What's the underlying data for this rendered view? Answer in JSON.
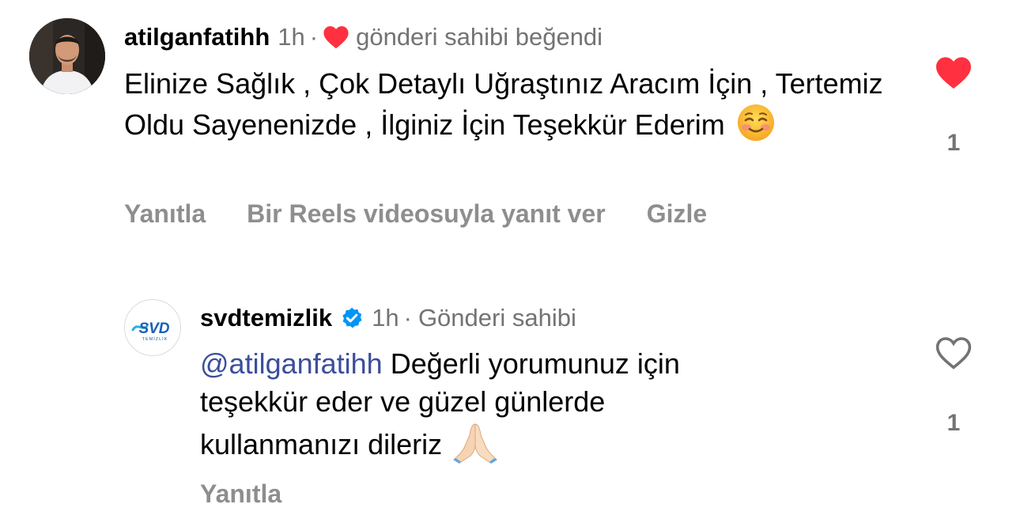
{
  "comments": [
    {
      "username": "atilganfatihh",
      "time": "1h",
      "separator": "·",
      "owner_liked_text": "gönderi sahibi beğendi",
      "body": "Elinize Sağlık , Çok Detaylı Uğraştınız Aracım İçin , Tertemiz Oldu Sayenenizde , İlginiz İçin Teşekkür Ederim",
      "emoji": "smiling-face-emoji",
      "actions": {
        "reply": "Yanıtla",
        "reels_reply": "Bir Reels videosuyla yanıt ver",
        "hide": "Gizle"
      },
      "liked": true,
      "like_count": "1"
    },
    {
      "username": "svdtemizlik",
      "verified": true,
      "time": "1h",
      "separator": "·",
      "role": "Gönderi sahibi",
      "mention": "@atilganfatihh",
      "body": "Değerli yorumunuz için teşekkür eder ve güzel günlerde kullanmanızı dileriz",
      "emoji": "folded-hands-emoji",
      "actions": {
        "reply": "Yanıtla"
      },
      "liked": false,
      "like_count": "1",
      "avatar_logo": {
        "main": "SVD",
        "sub": "TEMİZLİK"
      }
    }
  ],
  "colors": {
    "like_red": "#ff3040",
    "gray_text": "#737373",
    "action_gray": "#8e8e8e",
    "mention_blue": "#3b4e9b",
    "verified_blue": "#0095f6",
    "logo_blue": "#1a5fb4"
  }
}
